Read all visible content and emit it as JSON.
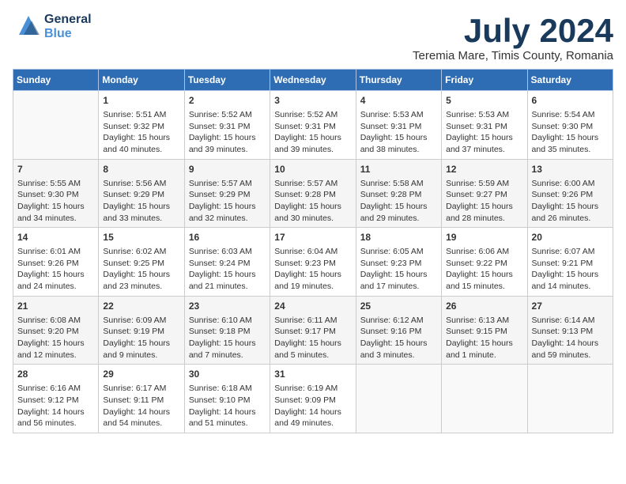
{
  "header": {
    "logo_line1": "General",
    "logo_line2": "Blue",
    "month_year": "July 2024",
    "location": "Teremia Mare, Timis County, Romania"
  },
  "days_of_week": [
    "Sunday",
    "Monday",
    "Tuesday",
    "Wednesday",
    "Thursday",
    "Friday",
    "Saturday"
  ],
  "weeks": [
    [
      {
        "day": "",
        "sunrise": "",
        "sunset": "",
        "daylight": ""
      },
      {
        "day": "1",
        "sunrise": "Sunrise: 5:51 AM",
        "sunset": "Sunset: 9:32 PM",
        "daylight": "Daylight: 15 hours and 40 minutes."
      },
      {
        "day": "2",
        "sunrise": "Sunrise: 5:52 AM",
        "sunset": "Sunset: 9:31 PM",
        "daylight": "Daylight: 15 hours and 39 minutes."
      },
      {
        "day": "3",
        "sunrise": "Sunrise: 5:52 AM",
        "sunset": "Sunset: 9:31 PM",
        "daylight": "Daylight: 15 hours and 39 minutes."
      },
      {
        "day": "4",
        "sunrise": "Sunrise: 5:53 AM",
        "sunset": "Sunset: 9:31 PM",
        "daylight": "Daylight: 15 hours and 38 minutes."
      },
      {
        "day": "5",
        "sunrise": "Sunrise: 5:53 AM",
        "sunset": "Sunset: 9:31 PM",
        "daylight": "Daylight: 15 hours and 37 minutes."
      },
      {
        "day": "6",
        "sunrise": "Sunrise: 5:54 AM",
        "sunset": "Sunset: 9:30 PM",
        "daylight": "Daylight: 15 hours and 35 minutes."
      }
    ],
    [
      {
        "day": "7",
        "sunrise": "Sunrise: 5:55 AM",
        "sunset": "Sunset: 9:30 PM",
        "daylight": "Daylight: 15 hours and 34 minutes."
      },
      {
        "day": "8",
        "sunrise": "Sunrise: 5:56 AM",
        "sunset": "Sunset: 9:29 PM",
        "daylight": "Daylight: 15 hours and 33 minutes."
      },
      {
        "day": "9",
        "sunrise": "Sunrise: 5:57 AM",
        "sunset": "Sunset: 9:29 PM",
        "daylight": "Daylight: 15 hours and 32 minutes."
      },
      {
        "day": "10",
        "sunrise": "Sunrise: 5:57 AM",
        "sunset": "Sunset: 9:28 PM",
        "daylight": "Daylight: 15 hours and 30 minutes."
      },
      {
        "day": "11",
        "sunrise": "Sunrise: 5:58 AM",
        "sunset": "Sunset: 9:28 PM",
        "daylight": "Daylight: 15 hours and 29 minutes."
      },
      {
        "day": "12",
        "sunrise": "Sunrise: 5:59 AM",
        "sunset": "Sunset: 9:27 PM",
        "daylight": "Daylight: 15 hours and 28 minutes."
      },
      {
        "day": "13",
        "sunrise": "Sunrise: 6:00 AM",
        "sunset": "Sunset: 9:26 PM",
        "daylight": "Daylight: 15 hours and 26 minutes."
      }
    ],
    [
      {
        "day": "14",
        "sunrise": "Sunrise: 6:01 AM",
        "sunset": "Sunset: 9:26 PM",
        "daylight": "Daylight: 15 hours and 24 minutes."
      },
      {
        "day": "15",
        "sunrise": "Sunrise: 6:02 AM",
        "sunset": "Sunset: 9:25 PM",
        "daylight": "Daylight: 15 hours and 23 minutes."
      },
      {
        "day": "16",
        "sunrise": "Sunrise: 6:03 AM",
        "sunset": "Sunset: 9:24 PM",
        "daylight": "Daylight: 15 hours and 21 minutes."
      },
      {
        "day": "17",
        "sunrise": "Sunrise: 6:04 AM",
        "sunset": "Sunset: 9:23 PM",
        "daylight": "Daylight: 15 hours and 19 minutes."
      },
      {
        "day": "18",
        "sunrise": "Sunrise: 6:05 AM",
        "sunset": "Sunset: 9:23 PM",
        "daylight": "Daylight: 15 hours and 17 minutes."
      },
      {
        "day": "19",
        "sunrise": "Sunrise: 6:06 AM",
        "sunset": "Sunset: 9:22 PM",
        "daylight": "Daylight: 15 hours and 15 minutes."
      },
      {
        "day": "20",
        "sunrise": "Sunrise: 6:07 AM",
        "sunset": "Sunset: 9:21 PM",
        "daylight": "Daylight: 15 hours and 14 minutes."
      }
    ],
    [
      {
        "day": "21",
        "sunrise": "Sunrise: 6:08 AM",
        "sunset": "Sunset: 9:20 PM",
        "daylight": "Daylight: 15 hours and 12 minutes."
      },
      {
        "day": "22",
        "sunrise": "Sunrise: 6:09 AM",
        "sunset": "Sunset: 9:19 PM",
        "daylight": "Daylight: 15 hours and 9 minutes."
      },
      {
        "day": "23",
        "sunrise": "Sunrise: 6:10 AM",
        "sunset": "Sunset: 9:18 PM",
        "daylight": "Daylight: 15 hours and 7 minutes."
      },
      {
        "day": "24",
        "sunrise": "Sunrise: 6:11 AM",
        "sunset": "Sunset: 9:17 PM",
        "daylight": "Daylight: 15 hours and 5 minutes."
      },
      {
        "day": "25",
        "sunrise": "Sunrise: 6:12 AM",
        "sunset": "Sunset: 9:16 PM",
        "daylight": "Daylight: 15 hours and 3 minutes."
      },
      {
        "day": "26",
        "sunrise": "Sunrise: 6:13 AM",
        "sunset": "Sunset: 9:15 PM",
        "daylight": "Daylight: 15 hours and 1 minute."
      },
      {
        "day": "27",
        "sunrise": "Sunrise: 6:14 AM",
        "sunset": "Sunset: 9:13 PM",
        "daylight": "Daylight: 14 hours and 59 minutes."
      }
    ],
    [
      {
        "day": "28",
        "sunrise": "Sunrise: 6:16 AM",
        "sunset": "Sunset: 9:12 PM",
        "daylight": "Daylight: 14 hours and 56 minutes."
      },
      {
        "day": "29",
        "sunrise": "Sunrise: 6:17 AM",
        "sunset": "Sunset: 9:11 PM",
        "daylight": "Daylight: 14 hours and 54 minutes."
      },
      {
        "day": "30",
        "sunrise": "Sunrise: 6:18 AM",
        "sunset": "Sunset: 9:10 PM",
        "daylight": "Daylight: 14 hours and 51 minutes."
      },
      {
        "day": "31",
        "sunrise": "Sunrise: 6:19 AM",
        "sunset": "Sunset: 9:09 PM",
        "daylight": "Daylight: 14 hours and 49 minutes."
      },
      {
        "day": "",
        "sunrise": "",
        "sunset": "",
        "daylight": ""
      },
      {
        "day": "",
        "sunrise": "",
        "sunset": "",
        "daylight": ""
      },
      {
        "day": "",
        "sunrise": "",
        "sunset": "",
        "daylight": ""
      }
    ]
  ]
}
